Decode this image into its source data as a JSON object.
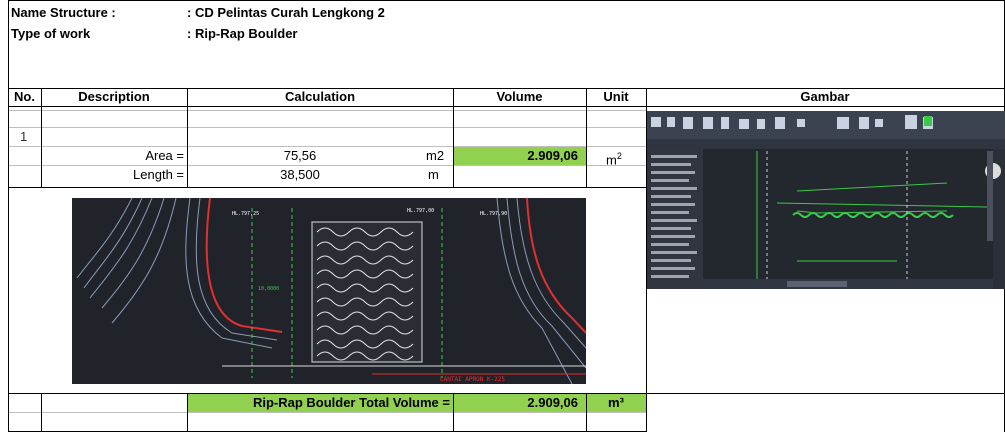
{
  "header": {
    "name_label": "Name Structure :",
    "name_value": ": CD Pelintas Curah Lengkong 2",
    "type_label": "Type of work",
    "type_value": ": Rip-Rap Boulder"
  },
  "columns": {
    "no": "No.",
    "description": "Description",
    "calculation": "Calculation",
    "volume": "Volume",
    "unit": "Unit",
    "gambar": "Gambar"
  },
  "row1": {
    "no": "1",
    "area_label": "Area =",
    "area_value": "75,56",
    "area_unit": "m2",
    "volume": "2.909,06",
    "volume_unit_base": "m",
    "volume_unit_exp": "2",
    "length_label": "Length =",
    "length_value": "38,500",
    "length_unit": "m"
  },
  "total": {
    "label": "Rip-Rap Boulder Total Volume =",
    "value": "2.909,06",
    "unit": "m³"
  },
  "drawing": {
    "label_a": "HL.797,25",
    "label_b": "HL.797,00",
    "label_c": "HL.797,90",
    "label_d": "10,0000",
    "callout": "LANTAI APRON K-225"
  },
  "colors": {
    "green": "#92d050",
    "cad_bg": "#20232a"
  }
}
